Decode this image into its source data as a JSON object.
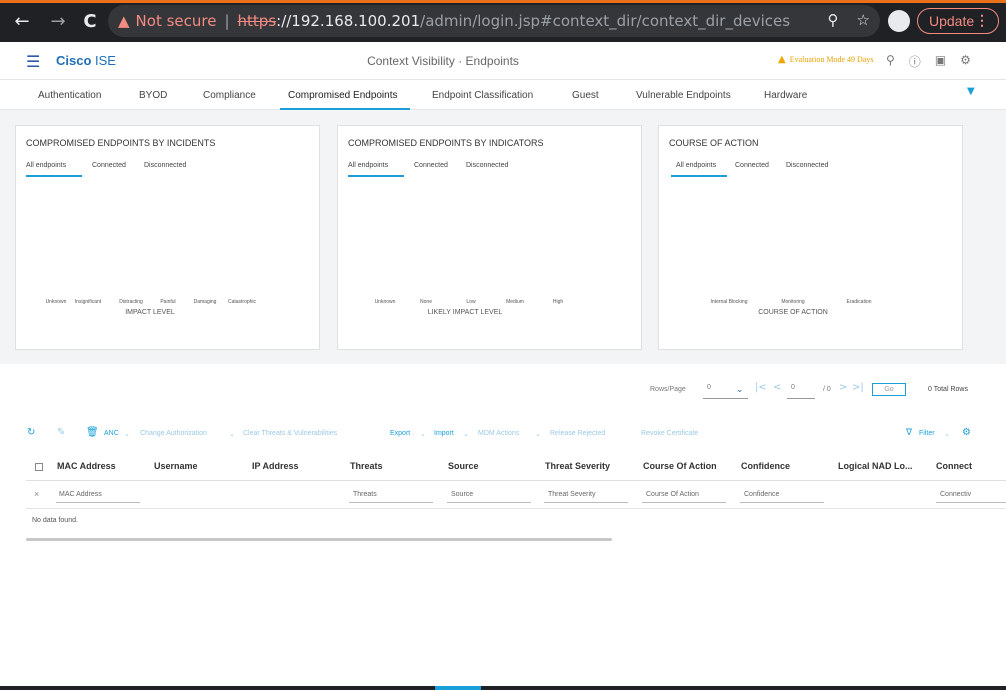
{
  "browser": {
    "back_icon": "back-arrow-icon",
    "forward_icon": "forward-arrow-icon",
    "reload_icon": "reload-icon",
    "not_secure": "Not secure",
    "url_scheme": "https",
    "url_host": "://192.168.100.201",
    "url_path": "/admin/login.jsp#context_dir/context_dir_devices",
    "update_label": "Update"
  },
  "header": {
    "brand_bold": "Cisco",
    "brand_light": " ISE",
    "title": "Context Visibility · Endpoints",
    "evaluation": "Evaluation Mode 49 Days"
  },
  "tabs": [
    {
      "label": "Authentication"
    },
    {
      "label": "BYOD"
    },
    {
      "label": "Compliance"
    },
    {
      "label": "Compromised Endpoints"
    },
    {
      "label": "Endpoint Classification"
    },
    {
      "label": "Guest"
    },
    {
      "label": "Vulnerable Endpoints"
    },
    {
      "label": "Hardware"
    }
  ],
  "panels": [
    {
      "title": "COMPROMISED ENDPOINTS BY INCIDENTS",
      "subtabs": [
        "All endpoints",
        "Connected",
        "Disconnected"
      ],
      "ticks": [
        "Unknown",
        "Insignificant",
        "Distracting",
        "Painful",
        "Damaging",
        "Catastrophic"
      ],
      "axis_label": "IMPACT LEVEL"
    },
    {
      "title": "COMPROMISED ENDPOINTS BY INDICATORS",
      "subtabs": [
        "All endpoints",
        "Connected",
        "Disconnected"
      ],
      "ticks": [
        "Unknown",
        "None",
        "Low",
        "Medium",
        "High"
      ],
      "axis_label": "LIKELY IMPACT LEVEL"
    },
    {
      "title": "COURSE OF ACTION",
      "subtabs": [
        "All endpoints",
        "Connected",
        "Disconnected"
      ],
      "ticks": [
        "Internal Blocking",
        "Monitoring",
        "Eradication"
      ],
      "axis_label": "COURSE OF ACTION"
    }
  ],
  "pagination": {
    "rows_per_page_label": "Rows/Page",
    "rows_per_page_value": "0",
    "page_value": "0",
    "page_total": "/ 0",
    "go_label": "Go",
    "total_rows": "0 Total Rows"
  },
  "toolbar": {
    "anc": "ANC",
    "change_authorization": "Change Authorization",
    "clear_threats": "Clear Threats & Vulnerabilities",
    "export": "Export",
    "import": "Import",
    "mdm_actions": "MDM Actions",
    "release_rejected": "Release Rejected",
    "revoke_certificate": "Revoke Certificate",
    "filter": "Filter"
  },
  "table": {
    "columns": [
      "MAC Address",
      "Username",
      "IP Address",
      "Threats",
      "Source",
      "Threat Severity",
      "Course Of Action",
      "Confidence",
      "Logical NAD Lo...",
      "Connect"
    ],
    "filters": [
      "MAC Address",
      "Threats",
      "Source",
      "Threat Severity",
      "Course Of Action",
      "Confidence",
      "Connectiv"
    ],
    "empty_text": "No data found."
  }
}
